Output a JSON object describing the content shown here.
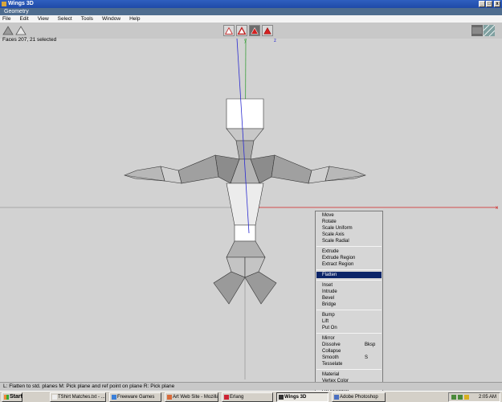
{
  "window": {
    "title": "Wings 3D",
    "subtitle": "Geometry"
  },
  "title_buttons": {
    "minimize": "_",
    "maximize": "□",
    "close": "x"
  },
  "menu": [
    "File",
    "Edit",
    "View",
    "Select",
    "Tools",
    "Window",
    "Help"
  ],
  "status": {
    "selection": "Faces 207, 21 selected"
  },
  "axes": {
    "y_label": "y",
    "z_label": "z",
    "x_label": "x"
  },
  "context_menu": {
    "groups": [
      [
        {
          "label": "Move",
          "shortcut": ""
        },
        {
          "label": "Rotate",
          "shortcut": ""
        },
        {
          "label": "Scale Uniform",
          "shortcut": ""
        },
        {
          "label": "Scale Axis",
          "shortcut": ""
        },
        {
          "label": "Scale Radial",
          "shortcut": ""
        }
      ],
      [
        {
          "label": "Extrude",
          "shortcut": ""
        },
        {
          "label": "Extrude Region",
          "shortcut": ""
        },
        {
          "label": "Extract Region",
          "shortcut": ""
        }
      ],
      [
        {
          "label": "Flatten",
          "shortcut": "",
          "highlighted": true
        }
      ],
      [
        {
          "label": "Inset",
          "shortcut": ""
        },
        {
          "label": "Intrude",
          "shortcut": ""
        },
        {
          "label": "Bevel",
          "shortcut": ""
        },
        {
          "label": "Bridge",
          "shortcut": ""
        }
      ],
      [
        {
          "label": "Bump",
          "shortcut": ""
        },
        {
          "label": "Lift",
          "shortcut": ""
        },
        {
          "label": "Put On",
          "shortcut": ""
        }
      ],
      [
        {
          "label": "Mirror",
          "shortcut": ""
        },
        {
          "label": "Dissolve",
          "shortcut": "Bksp"
        },
        {
          "label": "Collapse",
          "shortcut": ""
        },
        {
          "label": "Smooth",
          "shortcut": "S"
        },
        {
          "label": "Tesselate",
          "shortcut": ""
        }
      ],
      [
        {
          "label": "Material",
          "shortcut": ""
        },
        {
          "label": "Vertex Color",
          "shortcut": ""
        }
      ],
      [
        {
          "label": "UV Mapping",
          "shortcut": ""
        }
      ]
    ]
  },
  "hint_bar": "L: Flatten to std. planes   M: Pick plane and ref point on plane   R: Pick plane",
  "taskbar": {
    "start": "Start",
    "tasks": [
      {
        "label": "TShirt Matches.txt - ...",
        "active": false
      },
      {
        "label": "Freeware Games",
        "active": false
      },
      {
        "label": "Art Web Site - Mozilla",
        "active": false
      },
      {
        "label": "Erlang",
        "active": false
      },
      {
        "label": "Wings 3D",
        "active": true
      },
      {
        "label": "Adobe Photoshop",
        "active": false
      }
    ],
    "clock": "2:05 AM"
  },
  "colors": {
    "highlight": "#0b2468",
    "y_axis": "#3ca03c",
    "z_axis": "#2b2bd0",
    "x_axis": "#d02020"
  }
}
